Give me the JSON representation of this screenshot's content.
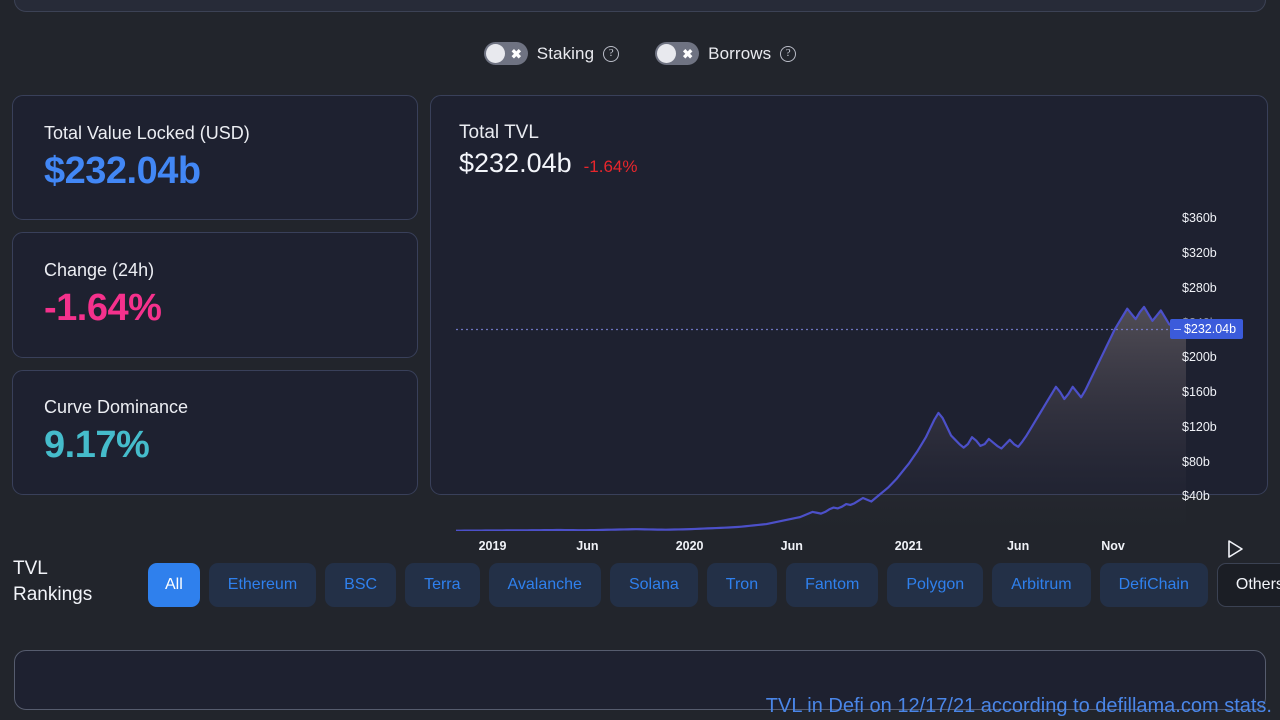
{
  "toggles": [
    {
      "label": "Staking",
      "state": "off",
      "icon": "x-icon",
      "help_icon": "question-circle-icon"
    },
    {
      "label": "Borrows",
      "state": "off",
      "icon": "x-icon",
      "help_icon": "question-circle-icon"
    }
  ],
  "stats": [
    {
      "title": "Total Value Locked (USD)",
      "value": "$232.04b",
      "color": "#4287f5"
    },
    {
      "title": "Change (24h)",
      "value": "-1.64%",
      "color": "#f5318c"
    },
    {
      "title": "Curve Dominance",
      "value": "9.17%",
      "color": "#45bccb"
    }
  ],
  "chart_card": {
    "title": "Total TVL",
    "value": "$232.04b",
    "change": "-1.64%",
    "change_color": "#e8262c",
    "play_button": "play-icon"
  },
  "chart_data": {
    "type": "area",
    "title": "Total TVL",
    "xlabel": "",
    "ylabel": "",
    "ylim": [
      0,
      380
    ],
    "yticks": [
      "$40b",
      "$80b",
      "$120b",
      "$160b",
      "$200b",
      "$240b",
      "$280b",
      "$320b",
      "$360b"
    ],
    "ytick_values": [
      40,
      80,
      120,
      160,
      200,
      240,
      280,
      320,
      360
    ],
    "highlighted_ytick": "$232.04b",
    "highlighted_value": 232.04,
    "xticks": [
      "2019",
      "Jun",
      "2020",
      "Jun",
      "2021",
      "Jun",
      "Nov"
    ],
    "xtick_positions": [
      0.05,
      0.18,
      0.32,
      0.46,
      0.62,
      0.77,
      0.9
    ],
    "grid": false,
    "line_color": "#4c50c9",
    "series": [
      {
        "name": "Total TVL",
        "values": [
          0.3,
          0.35,
          0.4,
          0.42,
          0.45,
          0.5,
          0.52,
          0.55,
          0.58,
          0.6,
          0.62,
          0.65,
          0.68,
          0.7,
          0.72,
          0.75,
          0.78,
          0.8,
          0.85,
          0.9,
          0.95,
          1.0,
          1.05,
          1.1,
          1.15,
          1.2,
          1.1,
          1.05,
          1.0,
          0.95,
          0.9,
          0.95,
          1.0,
          1.1,
          1.2,
          1.3,
          1.4,
          1.5,
          1.6,
          1.7,
          1.8,
          1.9,
          2.0,
          2.1,
          2.0,
          1.9,
          1.8,
          1.7,
          1.6,
          1.55,
          1.5,
          1.6,
          1.7,
          1.8,
          1.9,
          2.0,
          2.2,
          2.4,
          2.6,
          2.8,
          3.0,
          3.2,
          3.4,
          3.6,
          3.8,
          4.0,
          4.3,
          4.6,
          5.0,
          5.5,
          6.0,
          6.5,
          7.0,
          7.5,
          8.0,
          9.0,
          10.0,
          11.0,
          12.0,
          13.0,
          14.0,
          15.0,
          16.0,
          18.0,
          20.0,
          22.0,
          21.0,
          20.0,
          22.0,
          25.0,
          27.0,
          26.0,
          28.0,
          31.0,
          30.0,
          32.0,
          35.0,
          38.0,
          36.0,
          34.0,
          38.0,
          42.0,
          46.0,
          50.0,
          55.0,
          60.0,
          66.0,
          72.0,
          78.0,
          85.0,
          92.0,
          100.0,
          108.0,
          118.0,
          128.0,
          136.0,
          130.0,
          120.0,
          110.0,
          105.0,
          100.0,
          96.0,
          100.0,
          108.0,
          104.0,
          98.0,
          100.0,
          106.0,
          102.0,
          98.0,
          95.0,
          100.0,
          105.0,
          100.0,
          97.0,
          103.0,
          110.0,
          118.0,
          126.0,
          134.0,
          142.0,
          150.0,
          158.0,
          166.0,
          160.0,
          152.0,
          158.0,
          166.0,
          160.0,
          154.0,
          162.0,
          172.0,
          182.0,
          192.0,
          202.0,
          212.0,
          222.0,
          232.0,
          240.0,
          248.0,
          256.0,
          250.0,
          244.0,
          252.0,
          258.0,
          250.0,
          242.0,
          248.0,
          254.0,
          246.0,
          238.0,
          236.0,
          240.0,
          236.0,
          232.04
        ]
      }
    ]
  },
  "rankings": {
    "label": "TVL Rankings",
    "chips": [
      {
        "label": "All",
        "active": true
      },
      {
        "label": "Ethereum",
        "active": false
      },
      {
        "label": "BSC",
        "active": false
      },
      {
        "label": "Terra",
        "active": false
      },
      {
        "label": "Avalanche",
        "active": false
      },
      {
        "label": "Solana",
        "active": false
      },
      {
        "label": "Tron",
        "active": false
      },
      {
        "label": "Fantom",
        "active": false
      },
      {
        "label": "Polygon",
        "active": false
      },
      {
        "label": "Arbitrum",
        "active": false
      },
      {
        "label": "DefiChain",
        "active": false
      }
    ],
    "others": {
      "label": "Others",
      "icon": "chevron-down-icon"
    }
  },
  "caption": "TVL in Defi on 12/17/21 according to defillama.com stats."
}
